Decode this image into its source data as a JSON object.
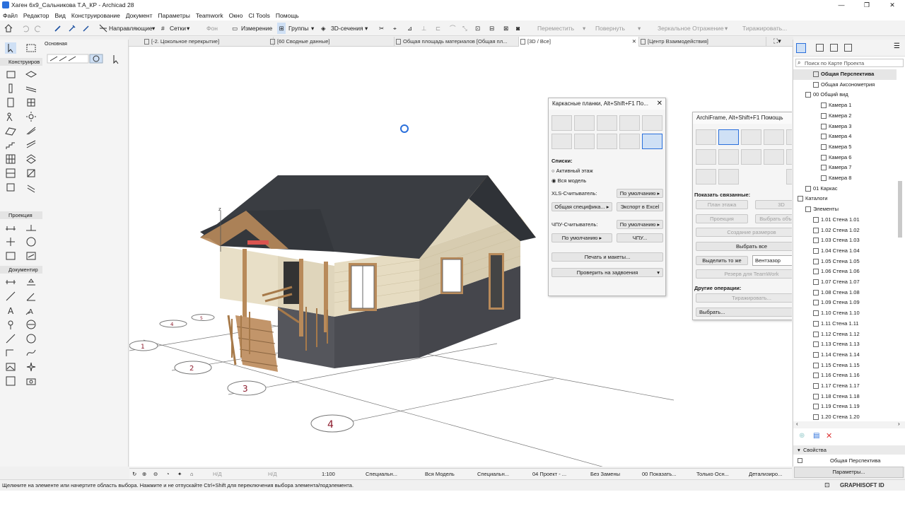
{
  "window": {
    "title": "Хаген 6х9_Сальникова Т.А_КР - Archicad 28",
    "minimize": "—",
    "maximize": "❐",
    "close": "✕"
  },
  "menu": [
    "Файл",
    "Редактор",
    "Вид",
    "Конструирование",
    "Документ",
    "Параметры",
    "Teamwork",
    "Окно",
    "CI Tools",
    "Помощь"
  ],
  "toolbar": {
    "guides": "Направляющие",
    "grids": "Сетки",
    "background": "Фон",
    "measure": "Измерение",
    "groups": "Группы",
    "sections3d": "3D-сечения",
    "move": "Переместить",
    "rotate": "Повернуть",
    "mirror": "Зеркальное Отражение",
    "multiply": "Тиражировать..."
  },
  "tabs": [
    "[-2. Цокольное перекрытие]",
    "[60 Сводные данные]",
    "Общая площадь материалов [Общая пл...",
    "[3D / Все]",
    "[Центр Взаимодействия]"
  ],
  "toolbox": {
    "top_label": "Основная",
    "section_design": "Конструиров",
    "section_view": "Проекция",
    "section_document": "Документир"
  },
  "frame_palette": {
    "title": "Каркасные планки, Alt+Shift+F1 По...",
    "lists_label": "Списки:",
    "radio_active": "Активный этаж",
    "radio_all": "Вся модель",
    "xls_label": "XLS-Считыватель:",
    "xls_default": "По умолчанию",
    "spec": "Общая специфика...",
    "export_excel": "Экспорт в Excel",
    "cnc_label": "ЧПУ-Считыватель:",
    "cnc_default": "По умолчанию",
    "cnc_default2": "По умолчанию",
    "cnc_btn": "ЧПУ...",
    "print": "Печать и макеты...",
    "check": "Проверить на задвоения"
  },
  "archiframe_palette": {
    "title": "ArchiFrame, Alt+Shift+F1 Помощь",
    "show_related": "Показать связанные:",
    "floor_plan": "План этажа",
    "btn_3d": "3D",
    "projection": "Проекция",
    "choose_obj": "Выбрать объе...",
    "create_dims": "Создание размеров",
    "select_all": "Выбрать все",
    "highlight_same": "Выделить то же",
    "value": "Вентзазор",
    "reserve": "Резерв для TeamWork",
    "other_ops": "Другие операции:",
    "multiply": "Тиражировать...",
    "choose": "Выбрать..."
  },
  "navigator": {
    "search_placeholder": "Поиск по Карте Проекта",
    "rows": [
      {
        "label": "Общая Перспектива",
        "level": 2,
        "sel": true
      },
      {
        "label": "Общая Аксонометрия",
        "level": 2
      },
      {
        "label": "00 Общий вид",
        "level": 1
      },
      {
        "label": "Камера 1",
        "level": 3
      },
      {
        "label": "Камера 2",
        "level": 3
      },
      {
        "label": "Камера 3",
        "level": 3
      },
      {
        "label": "Камера 4",
        "level": 3
      },
      {
        "label": "Камера 5",
        "level": 3
      },
      {
        "label": "Камера 6",
        "level": 3
      },
      {
        "label": "Камера 7",
        "level": 3
      },
      {
        "label": "Камера 8",
        "level": 3
      },
      {
        "label": "01 Каркас",
        "level": 1
      },
      {
        "label": "Каталоги",
        "level": 0
      },
      {
        "label": "Элементы",
        "level": 1
      },
      {
        "label": "1.01 Стена 1.01",
        "level": 2
      },
      {
        "label": "1.02 Стена 1.02",
        "level": 2
      },
      {
        "label": "1.03 Стена 1.03",
        "level": 2
      },
      {
        "label": "1.04 Стена 1.04",
        "level": 2
      },
      {
        "label": "1.05 Стена 1.05",
        "level": 2
      },
      {
        "label": "1.06 Стена 1.06",
        "level": 2
      },
      {
        "label": "1.07 Стена 1.07",
        "level": 2
      },
      {
        "label": "1.08 Стена 1.08",
        "level": 2
      },
      {
        "label": "1.09 Стена 1.09",
        "level": 2
      },
      {
        "label": "1.10 Стена 1.10",
        "level": 2
      },
      {
        "label": "1.11 Стена 1.11",
        "level": 2
      },
      {
        "label": "1.12 Стена 1.12",
        "level": 2
      },
      {
        "label": "1.13 Стена 1.13",
        "level": 2
      },
      {
        "label": "1.14 Стена 1.14",
        "level": 2
      },
      {
        "label": "1.15 Стена 1.15",
        "level": 2
      },
      {
        "label": "1.16 Стена 1.16",
        "level": 2
      },
      {
        "label": "1.17 Стена 1.17",
        "level": 2
      },
      {
        "label": "1.18 Стена 1.18",
        "level": 2
      },
      {
        "label": "1.19 Стена 1.19",
        "level": 2
      },
      {
        "label": "1.20 Стена 1.20",
        "level": 2
      }
    ],
    "properties": "Свойства",
    "prop_value": "Общая Перспектива",
    "params_btn": "Параметры..."
  },
  "navbar": {
    "nd1": "Н/Д",
    "nd2": "Н/Д",
    "scale": "1:100",
    "special1": "Специальн...",
    "model": "Вся Модель",
    "special2": "Специальн...",
    "project": "04 Проект - ...",
    "nochange": "Без Замены",
    "show": "00 Показать...",
    "only": "Только Осн...",
    "detail": "Детализиро..."
  },
  "status": {
    "text": "Щелкните на элементе или начертите область выбора. Нажмите и не отпускайте Ctrl+Shift для переключения выбора элемента/подэлемента.",
    "brand": "GRAPHISOFT ID"
  },
  "model": {
    "axis_z": "z",
    "markers": [
      "1",
      "2",
      "3",
      "4",
      "4",
      "5"
    ]
  },
  "colors": {
    "roof": "#3a3d42",
    "siding": "#e6dcc3",
    "wood": "#b88a5a",
    "plinth": "#5a5a5f",
    "accent": "#2a6fdb"
  }
}
